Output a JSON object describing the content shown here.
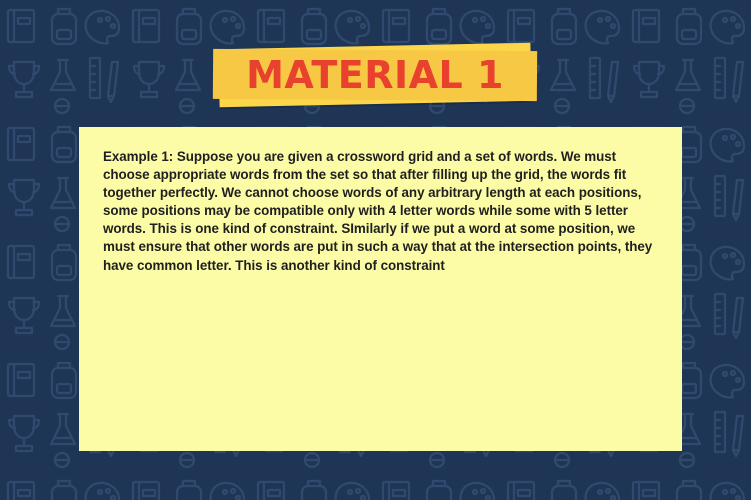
{
  "title": "MATERIAL 1",
  "content": {
    "text": "Example 1: Suppose you are given a crossword grid and a set of words. We must choose appropriate words from the set so that after filling up the grid, the words fit together perfectly. We cannot choose words of any arbitrary length at each positions, some positions may be compatible only with 4 letter words while some with 5 letter words. This is one kind of constraint. SImilarly if we put a word at some position, we must ensure that other words are put in such a way that at the intersection points, they have common letter. This is another kind of constraint"
  },
  "colors": {
    "background": "#1f3555",
    "banner": "#fcd64a",
    "title_text": "#e8412e",
    "card": "#fcfca6",
    "body_text": "#1f1f1f"
  },
  "background_icons": [
    "book-icon",
    "backpack-icon",
    "palette-icon",
    "trophy-icon",
    "flask-icon",
    "ruler-icon",
    "pencil-icon",
    "globe-icon"
  ]
}
